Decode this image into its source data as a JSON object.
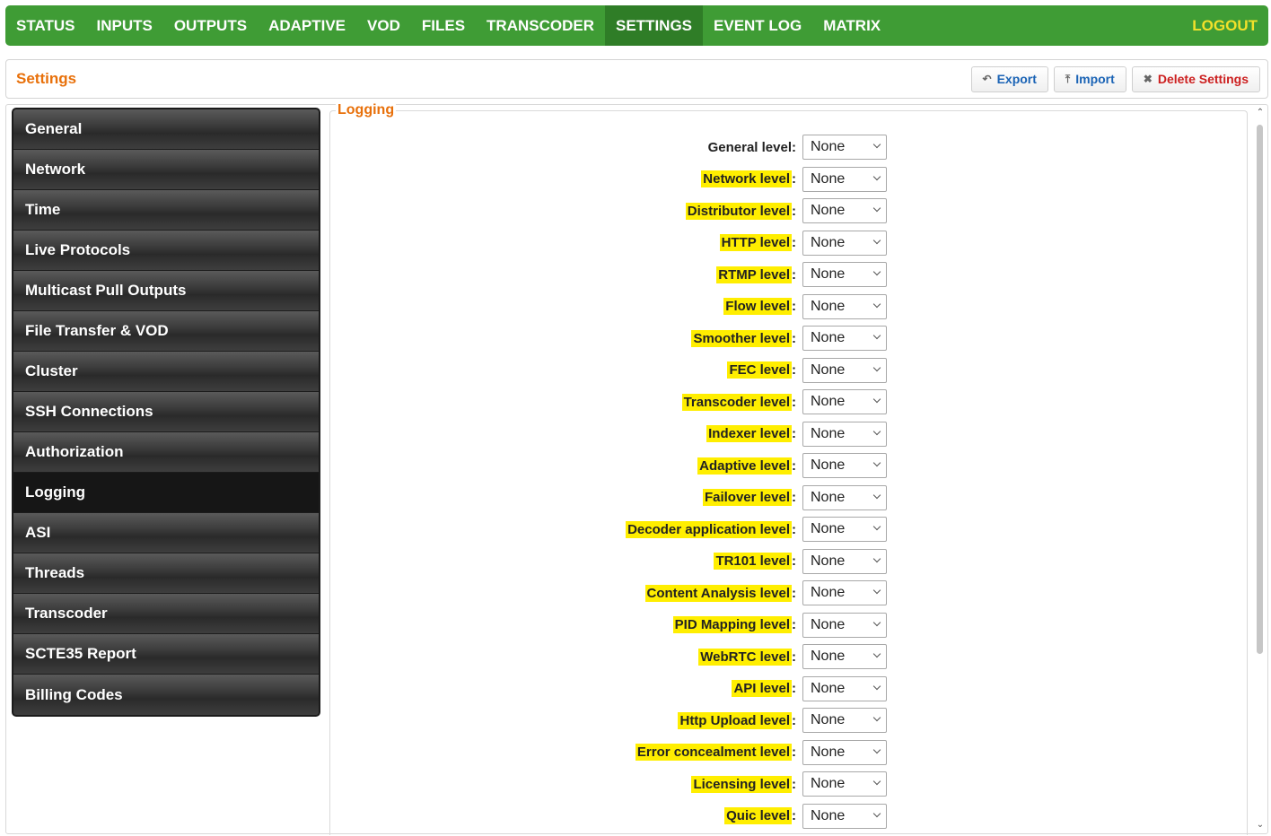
{
  "nav": {
    "tabs": [
      {
        "label": "STATUS"
      },
      {
        "label": "INPUTS"
      },
      {
        "label": "OUTPUTS"
      },
      {
        "label": "ADAPTIVE"
      },
      {
        "label": "VOD"
      },
      {
        "label": "FILES"
      },
      {
        "label": "TRANSCODER"
      },
      {
        "label": "SETTINGS"
      },
      {
        "label": "EVENT LOG"
      },
      {
        "label": "MATRIX"
      }
    ],
    "active_tab": "SETTINGS",
    "logout": "LOGOUT"
  },
  "header": {
    "title": "Settings",
    "export_label": "Export",
    "import_label": "Import",
    "delete_label": "Delete Settings"
  },
  "sidebar": {
    "items": [
      {
        "label": "General"
      },
      {
        "label": "Network"
      },
      {
        "label": "Time"
      },
      {
        "label": "Live Protocols"
      },
      {
        "label": "Multicast Pull Outputs"
      },
      {
        "label": "File Transfer & VOD"
      },
      {
        "label": "Cluster"
      },
      {
        "label": "SSH Connections"
      },
      {
        "label": "Authorization"
      },
      {
        "label": "Logging"
      },
      {
        "label": "ASI"
      },
      {
        "label": "Threads"
      },
      {
        "label": "Transcoder"
      },
      {
        "label": "SCTE35 Report"
      },
      {
        "label": "Billing Codes"
      }
    ],
    "active_item": "Logging"
  },
  "logging": {
    "legend": "Logging",
    "rows": [
      {
        "label": "General level",
        "value": "None",
        "highlighted": false
      },
      {
        "label": "Network level",
        "value": "None",
        "highlighted": true
      },
      {
        "label": "Distributor level",
        "value": "None",
        "highlighted": true
      },
      {
        "label": "HTTP level",
        "value": "None",
        "highlighted": true
      },
      {
        "label": "RTMP level",
        "value": "None",
        "highlighted": true
      },
      {
        "label": "Flow level",
        "value": "None",
        "highlighted": true
      },
      {
        "label": "Smoother level",
        "value": "None",
        "highlighted": true
      },
      {
        "label": "FEC level",
        "value": "None",
        "highlighted": true
      },
      {
        "label": "Transcoder level",
        "value": "None",
        "highlighted": true
      },
      {
        "label": "Indexer level",
        "value": "None",
        "highlighted": true
      },
      {
        "label": "Adaptive level",
        "value": "None",
        "highlighted": true
      },
      {
        "label": "Failover level",
        "value": "None",
        "highlighted": true
      },
      {
        "label": "Decoder application level",
        "value": "None",
        "highlighted": true
      },
      {
        "label": "TR101 level",
        "value": "None",
        "highlighted": true
      },
      {
        "label": "Content Analysis level",
        "value": "None",
        "highlighted": true
      },
      {
        "label": "PID Mapping level",
        "value": "None",
        "highlighted": true
      },
      {
        "label": "WebRTC level",
        "value": "None",
        "highlighted": true
      },
      {
        "label": "API level",
        "value": "None",
        "highlighted": true
      },
      {
        "label": "Http Upload level",
        "value": "None",
        "highlighted": true
      },
      {
        "label": "Error concealment level",
        "value": "None",
        "highlighted": true
      },
      {
        "label": "Licensing level",
        "value": "None",
        "highlighted": true
      },
      {
        "label": "Quic level",
        "value": "None",
        "highlighted": true
      }
    ]
  },
  "colors": {
    "nav_green": "#3f9c35",
    "logout_yellow": "#f2e12a",
    "accent_orange": "#e8700a",
    "highlight_yellow": "#ffee00"
  }
}
